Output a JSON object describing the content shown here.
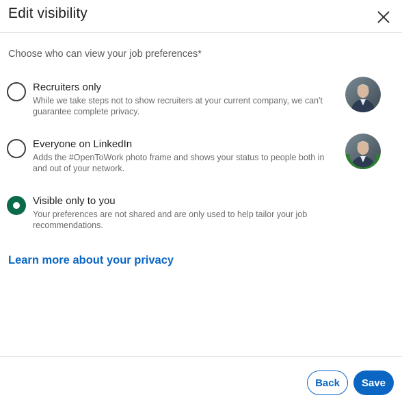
{
  "dialog": {
    "title": "Edit visibility",
    "close_icon": "close-icon"
  },
  "prompt": "Choose who can view your job preferences*",
  "options": [
    {
      "label": "Recruiters only",
      "description": "While we take steps not to show recruiters at your current company, we can't guarantee complete privacy.",
      "selected": false,
      "avatar": "profile-photo",
      "avatar_frame": null
    },
    {
      "label": "Everyone on LinkedIn",
      "description": "Adds the #OpenToWork photo frame and shows your status to people both in and out of your network.",
      "selected": false,
      "avatar": "profile-photo-opentowork",
      "avatar_frame": "#OPENTOWORK"
    },
    {
      "label": "Visible only to you",
      "description": "Your preferences are not shared and are only used to help tailor your job recommendations.",
      "selected": true,
      "avatar": null,
      "avatar_frame": null
    }
  ],
  "learn_more": "Learn more about your privacy",
  "footer": {
    "back_label": "Back",
    "save_label": "Save"
  },
  "colors": {
    "accent": "#0a66c2",
    "radio_selected": "#0a6a4a",
    "opentowork_frame": "#2e7d32"
  }
}
